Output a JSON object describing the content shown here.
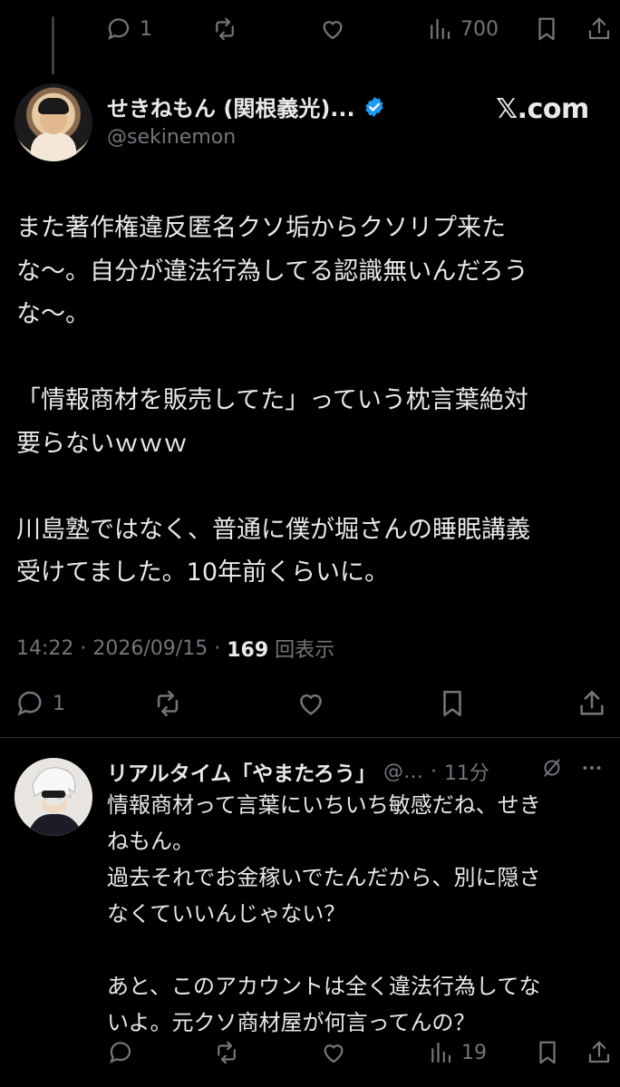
{
  "top_actions": {
    "reply_count": "1",
    "views_count": "700"
  },
  "tweet": {
    "display_name": "せきねもん (関根義光)...",
    "handle": "@sekinemon",
    "source_label": "𝕏.com",
    "paragraphs": [
      "また著作権違反匿名クソ垢からクソリプ来た\nな〜。自分が違法行為してる認識無いんだろう\nな〜。",
      "「情報商材を販売してた」っていう枕言葉絶対\n要らないｗｗｗ",
      "川島塾ではなく、普通に僕が堀さんの睡眠講義\n受けてました。10年前くらいに。"
    ],
    "time": "14:22",
    "date": "2026/09/15",
    "views": "169",
    "views_label": "回表示",
    "reply_count": "1"
  },
  "reply": {
    "display_name": "リアルタイム「やまたろう」",
    "handle": "@…",
    "time": "11分",
    "paragraphs": [
      "情報商材って言葉にいちいち敏感だね、せき\nねもん。\n過去それでお金稼いでたんだから、別に隠さ\nなくていいんじゃない？",
      "あと、このアカウントは全く違法行為してな\nいよ。元クソ商材屋が何言ってんの？"
    ],
    "views_count": "19"
  },
  "colors": {
    "background": "#000000",
    "text": "#e7e9ea",
    "muted": "#71767b",
    "verified": "#1d9bf0"
  }
}
